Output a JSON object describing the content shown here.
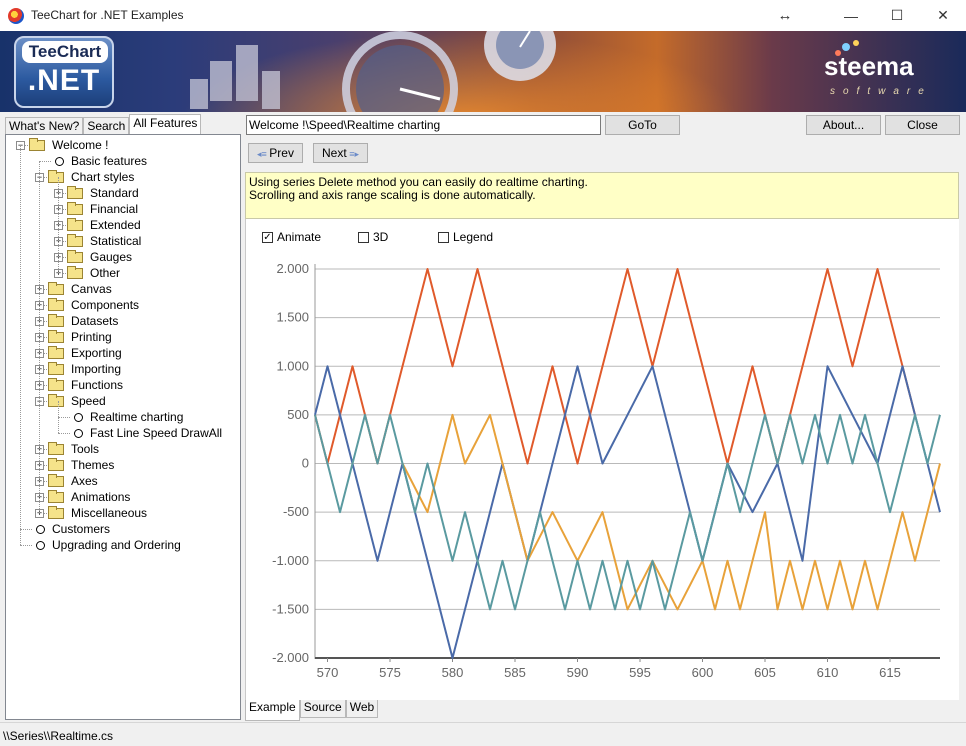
{
  "window": {
    "title": "TeeChart for .NET Examples",
    "controls": {
      "resize": "↔",
      "minimize": "—",
      "maximize": "☐",
      "close": "✕"
    }
  },
  "banner": {
    "logo_top": "TeeChart",
    "logo_bottom": ".NET",
    "brand": "steema",
    "brand_sub": "software"
  },
  "left_tabs": [
    {
      "label": "What's New?",
      "active": false
    },
    {
      "label": "Search",
      "active": false
    },
    {
      "label": "All Features",
      "active": true
    }
  ],
  "tree": [
    {
      "label": "Welcome !",
      "level": 0,
      "type": "folder-open",
      "expander": "−"
    },
    {
      "label": "Basic features",
      "level": 1,
      "type": "leaf"
    },
    {
      "label": "Chart styles",
      "level": 1,
      "type": "folder-open",
      "expander": "−"
    },
    {
      "label": "Standard",
      "level": 2,
      "type": "folder",
      "expander": "+"
    },
    {
      "label": "Financial",
      "level": 2,
      "type": "folder",
      "expander": "+"
    },
    {
      "label": "Extended",
      "level": 2,
      "type": "folder",
      "expander": "+"
    },
    {
      "label": "Statistical",
      "level": 2,
      "type": "folder",
      "expander": "+"
    },
    {
      "label": "Gauges",
      "level": 2,
      "type": "folder",
      "expander": "+"
    },
    {
      "label": "Other",
      "level": 2,
      "type": "folder",
      "expander": "+"
    },
    {
      "label": "Canvas",
      "level": 1,
      "type": "folder",
      "expander": "+"
    },
    {
      "label": "Components",
      "level": 1,
      "type": "folder",
      "expander": "+"
    },
    {
      "label": "Datasets",
      "level": 1,
      "type": "folder",
      "expander": "+"
    },
    {
      "label": "Printing",
      "level": 1,
      "type": "folder",
      "expander": "+"
    },
    {
      "label": "Exporting",
      "level": 1,
      "type": "folder",
      "expander": "+"
    },
    {
      "label": "Importing",
      "level": 1,
      "type": "folder",
      "expander": "+"
    },
    {
      "label": "Functions",
      "level": 1,
      "type": "folder",
      "expander": "+"
    },
    {
      "label": "Speed",
      "level": 1,
      "type": "folder-open",
      "expander": "−"
    },
    {
      "label": "Realtime charting",
      "level": 2,
      "type": "leaf"
    },
    {
      "label": "Fast Line Speed DrawAll",
      "level": 2,
      "type": "leaf"
    },
    {
      "label": "Tools",
      "level": 1,
      "type": "folder",
      "expander": "+"
    },
    {
      "label": "Themes",
      "level": 1,
      "type": "folder",
      "expander": "+"
    },
    {
      "label": "Axes",
      "level": 1,
      "type": "folder",
      "expander": "+"
    },
    {
      "label": "Animations",
      "level": 1,
      "type": "folder",
      "expander": "+"
    },
    {
      "label": "Miscellaneous",
      "level": 1,
      "type": "folder",
      "expander": "+"
    },
    {
      "label": "Customers",
      "level": 0,
      "type": "leaf"
    },
    {
      "label": "Upgrading and Ordering",
      "level": 0,
      "type": "leaf"
    }
  ],
  "toolbar": {
    "path_value": "Welcome !\\Speed\\Realtime charting",
    "goto_label": "GoTo",
    "about_label": "About...",
    "close_label": "Close",
    "prev_label": "Prev",
    "next_label": "Next"
  },
  "description": {
    "line1": "Using series Delete method you can easily do realtime charting.",
    "line2": "Scrolling and axis range scaling is done automatically."
  },
  "options": [
    {
      "label": "Animate",
      "checked": true
    },
    {
      "label": "3D",
      "checked": false
    },
    {
      "label": "Legend",
      "checked": false
    }
  ],
  "bottom_tabs": [
    {
      "label": "Example",
      "active": true
    },
    {
      "label": "Source",
      "active": false
    },
    {
      "label": "Web",
      "active": false
    }
  ],
  "status": {
    "text": "\\\\Series\\\\Realtime.cs"
  },
  "chart_data": {
    "type": "line",
    "xlim": [
      569,
      619
    ],
    "ylim": [
      -2000,
      2000
    ],
    "x_ticks": [
      570,
      575,
      580,
      585,
      590,
      595,
      600,
      605,
      610,
      615
    ],
    "y_ticks": [
      2000,
      1500,
      1000,
      500,
      0,
      -500,
      -1000,
      -1500,
      -2000
    ],
    "y_tick_labels": [
      "2.000",
      "1.500",
      "1.000",
      "500",
      "0",
      "-500",
      "-1.000",
      "-1.500",
      "-2.000"
    ],
    "grid": true,
    "colors": [
      "#e05a2b",
      "#4a6aa8",
      "#e8a23a",
      "#5a9aa0"
    ],
    "series": [
      {
        "x": [
          569,
          570,
          572,
          574,
          576,
          578,
          580,
          582,
          584,
          586,
          588,
          590,
          592,
          594,
          596,
          598,
          600,
          602,
          604,
          606,
          608,
          610,
          612,
          614,
          616,
          617
        ],
        "y": [
          500,
          0,
          1000,
          0,
          1000,
          2000,
          1000,
          2000,
          1000,
          0,
          1000,
          0,
          1000,
          2000,
          1000,
          2000,
          1000,
          0,
          1000,
          0,
          1000,
          2000,
          1000,
          2000,
          1000,
          500
        ]
      },
      {
        "x": [
          569,
          570,
          572,
          574,
          576,
          578,
          580,
          582,
          584,
          586,
          588,
          590,
          592,
          594,
          596,
          598,
          600,
          602,
          604,
          606,
          608,
          610,
          612,
          614,
          616,
          618,
          619
        ],
        "y": [
          500,
          1000,
          0,
          -1000,
          0,
          -1000,
          -2000,
          -1000,
          0,
          -1000,
          0,
          1000,
          0,
          500,
          1000,
          0,
          -1000,
          0,
          -500,
          0,
          -1000,
          1000,
          500,
          0,
          1000,
          0,
          -500
        ]
      },
      {
        "x": [
          576,
          578,
          579,
          580,
          581,
          583,
          584,
          586,
          588,
          590,
          592,
          594,
          596,
          598,
          600,
          601,
          602,
          603,
          604,
          605,
          606,
          607,
          608,
          609,
          610,
          611,
          612,
          613,
          614,
          615,
          616,
          617,
          618,
          619
        ],
        "y": [
          0,
          -500,
          0,
          500,
          0,
          500,
          0,
          -1000,
          -500,
          -1000,
          -500,
          -1500,
          -1000,
          -1500,
          -1000,
          -1500,
          -1000,
          -1500,
          -1000,
          -500,
          -1500,
          -1000,
          -1500,
          -1000,
          -1500,
          -1000,
          -1500,
          -1000,
          -1500,
          -1000,
          -500,
          -1000,
          -500,
          0
        ]
      },
      {
        "x": [
          569,
          570,
          571,
          572,
          573,
          574,
          575,
          576,
          577,
          578,
          579,
          580,
          581,
          582,
          583,
          584,
          585,
          586,
          587,
          588,
          589,
          590,
          591,
          592,
          593,
          594,
          595,
          596,
          597,
          598,
          599,
          600,
          601,
          602,
          603,
          604,
          605,
          606,
          607,
          608,
          609,
          610,
          611,
          612,
          613,
          614,
          615,
          616,
          617,
          618,
          619
        ],
        "y": [
          500,
          0,
          -500,
          0,
          500,
          0,
          500,
          0,
          -500,
          0,
          -500,
          -1000,
          -500,
          -1000,
          -1500,
          -1000,
          -1500,
          -1000,
          -500,
          -1000,
          -1500,
          -1000,
          -1500,
          -1000,
          -1500,
          -1000,
          -1500,
          -1000,
          -1500,
          -1000,
          -500,
          -1000,
          -500,
          0,
          -500,
          0,
          500,
          0,
          500,
          0,
          500,
          0,
          500,
          0,
          500,
          0,
          -500,
          0,
          500,
          0,
          500
        ]
      }
    ]
  }
}
